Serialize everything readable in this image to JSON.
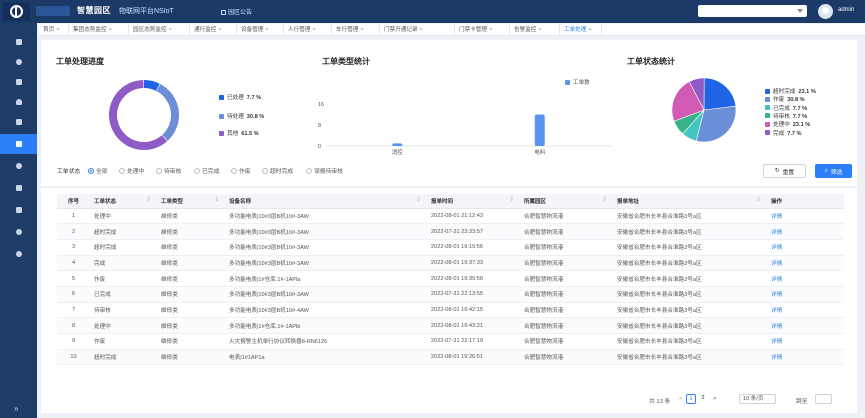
{
  "header": {
    "brand": "智慧园区",
    "platform": "物联网平台NSIoT",
    "notice": "园区公告",
    "user": "admin"
  },
  "tabs": [
    {
      "label": "首页"
    },
    {
      "label": "集团态势监控"
    },
    {
      "label": "园区态势监控"
    },
    {
      "label": "通行监控"
    },
    {
      "label": "设备管理"
    },
    {
      "label": "人行管理"
    },
    {
      "label": "车行管理"
    },
    {
      "label": "门禁开通记录"
    },
    {
      "label": "门禁卡管理"
    },
    {
      "label": "告警监控"
    },
    {
      "label": "工单处理"
    }
  ],
  "sections": {
    "progress": "工单处理进度",
    "types": "工单类型统计",
    "status": "工单状态统计"
  },
  "progress_chart": {
    "items": [
      {
        "label": "已处理",
        "value": "7.7 %",
        "pct": 7.7,
        "color": "#1f63e6"
      },
      {
        "label": "待处理",
        "value": "30.8 %",
        "pct": 30.8,
        "color": "#6b8fd6"
      },
      {
        "label": "其他",
        "value": "61.5 %",
        "pct": 61.5,
        "color": "#8e5bc7"
      }
    ]
  },
  "chart_data": {
    "type": "bar",
    "categories": [
      "消控",
      "电料"
    ],
    "values": [
      1,
      12
    ],
    "ylim": [
      0,
      16
    ],
    "yticks": [
      "16",
      "8",
      "0"
    ],
    "legend": "工单数",
    "color": "#5a93f0"
  },
  "status_chart": {
    "items": [
      {
        "label": "超时完成",
        "value": "23.1 %",
        "pct": 23.1,
        "color": "#1f63e6"
      },
      {
        "label": "作废",
        "value": "30.8 %",
        "pct": 30.8,
        "color": "#6b8fd6"
      },
      {
        "label": "已完成",
        "value": "7.7 %",
        "pct": 7.7,
        "color": "#43c6c2"
      },
      {
        "label": "待审核",
        "value": "7.7 %",
        "pct": 7.7,
        "color": "#37b38a"
      },
      {
        "label": "处理中",
        "value": "23.1 %",
        "pct": 23.1,
        "color": "#d15ab5"
      },
      {
        "label": "完成",
        "value": "7.7 %",
        "pct": 7.7,
        "color": "#8e5bc7"
      }
    ]
  },
  "filters": {
    "label": "工单状态",
    "options": [
      "全部",
      "处理中",
      "待审核",
      "已完成",
      "作废",
      "超时完成",
      "误报待审核"
    ],
    "reset": "重置",
    "filter": "筛选"
  },
  "table": {
    "columns": [
      "序号",
      "工单状态",
      "工单类型",
      "设备名称",
      "报单时间",
      "所属园区",
      "报单地址",
      "操作"
    ],
    "rows": [
      [
        "1",
        "处理中",
        "维修类",
        "多功能电表|10#3层B机10#-3AW",
        "2022-08-01 21:12:43",
        "合肥智慧物流港",
        "安徽省合肥市长丰县合淮路3号a区",
        "详情"
      ],
      [
        "2",
        "超时完成",
        "维修类",
        "多功能电表|10#3层B机10#-3AW",
        "2022-07-31 23:33:57",
        "合肥智慧物流港",
        "安徽省合肥市长丰县合淮路3号a区",
        "详情"
      ],
      [
        "3",
        "超时完成",
        "维修类",
        "多功能电表|10#3层B机10#-3AW",
        "2022-08-01 19:19:56",
        "合肥智慧物流港",
        "安徽省合肥市长丰县合淮路3号a区",
        "详情"
      ],
      [
        "4",
        "完成",
        "维修类",
        "多功能电表|10#3层B机10#-3AW",
        "2022-08-01 19:37:33",
        "合肥智慧物流港",
        "安徽省合肥市长丰县合淮路3号a区",
        "详情"
      ],
      [
        "5",
        "作废",
        "维修类",
        "多功能电表|1#仓库.1#-1APla",
        "2022-08-01 19:39:58",
        "合肥智慧物流港",
        "安徽省合肥市长丰县合淮路3号a区",
        "详情"
      ],
      [
        "6",
        "已完成",
        "维修类",
        "多功能电表|10#3层B机10#-3AW",
        "2022-07-31 22:13:55",
        "合肥智慧物流港",
        "安徽省合肥市长丰县合淮路3号a区",
        "详情"
      ],
      [
        "7",
        "待审核",
        "维修类",
        "多功能电表|10#3层B机10#-4AW",
        "2022-08-01 19:42:15",
        "合肥智慧物流港",
        "安徽省合肥市长丰县合淮路3号a区",
        "详情"
      ],
      [
        "8",
        "处理中",
        "维修类",
        "多功能电表|1#仓库.1#-1APlb",
        "2022-08-01 19:43:21",
        "合肥智慧物流港",
        "安徽省合肥市长丰县合淮路3号a区",
        "详情"
      ],
      [
        "9",
        "作废",
        "维修类",
        "火灾报警主机单行协议转换器8-RN6126",
        "2022-07-31 22:17:19",
        "合肥智慧物流港",
        "安徽省合肥市长丰县合淮路3号a区",
        "详情"
      ],
      [
        "10",
        "超时完成",
        "维修类",
        "电表|1#1AP1a",
        "2022-08-01 19:26:51",
        "合肥智慧物流港",
        "安徽省合肥市长丰县合淮路3号a区",
        "详情"
      ]
    ]
  },
  "pagination": {
    "total": "共 13 条",
    "prev": "<",
    "page1": "1",
    "page2": "2",
    "next": ">",
    "size": "10 条/页",
    "jump": "跳至"
  }
}
